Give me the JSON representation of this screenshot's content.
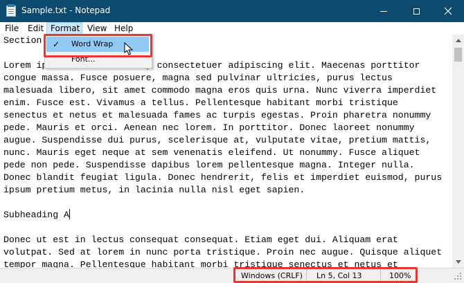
{
  "window": {
    "title": "Sample.txt - Notepad",
    "controls": {
      "minimize": "minimize",
      "maximize": "maximize",
      "close": "close"
    }
  },
  "menu": {
    "items": [
      "File",
      "Edit",
      "Format",
      "View",
      "Help"
    ],
    "active": "Format"
  },
  "format_menu": {
    "items": [
      {
        "label": "Word Wrap",
        "checked": true,
        "hovered": true
      },
      {
        "label": "Font...",
        "checked": false,
        "hovered": false
      }
    ]
  },
  "document": {
    "lines": [
      "Section",
      "",
      "Lorem ipsum dolor sit amet, consectetuer adipiscing elit. Maecenas porttitor",
      "congue massa. Fusce posuere, magna sed pulvinar ultricies, purus lectus",
      "malesuada libero, sit amet commodo magna eros quis urna. Nunc viverra imperdiet",
      "enim. Fusce est. Vivamus a tellus. Pellentesque habitant morbi tristique",
      "senectus et netus et malesuada fames ac turpis egestas. Proin pharetra nonummy",
      "pede. Mauris et orci. Aenean nec lorem. In porttitor. Donec laoreet nonummy",
      "augue. Suspendisse dui purus, scelerisque at, vulputate vitae, pretium mattis,",
      "nunc. Mauris eget neque at sem venenatis eleifend. Ut nonummy. Fusce aliquet",
      "pede non pede. Suspendisse dapibus lorem pellentesque magna. Integer nulla.",
      "Donec blandit feugiat ligula. Donec hendrerit, felis et imperdiet euismod, purus",
      "ipsum pretium metus, in lacinia nulla nisl eget sapien.",
      "",
      "Subheading A",
      "",
      "Donec ut est in lectus consequat consequat. Etiam eget dui. Aliquam erat",
      "volutpat. Sed at lorem in nunc porta tristique. Proin nec augue. Quisque aliquet",
      "tempor magna. Pellentesque habitant morbi tristique senectus et netus et"
    ],
    "caret_line": 14
  },
  "status_bar": {
    "encoding_line_ending": "Windows (CRLF)",
    "position": "Ln 5, Col 13",
    "zoom": "100%"
  },
  "colors": {
    "titlebar": "#0b4a6e",
    "highlight_box": "#e53935",
    "menu_hover": "#91c9f7"
  }
}
